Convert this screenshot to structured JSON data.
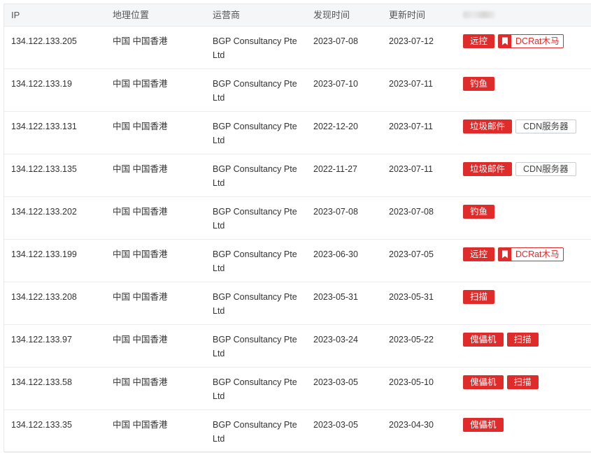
{
  "columns": [
    "IP",
    "地理位置",
    "运营商",
    "发现时间",
    "更新时间"
  ],
  "rows": [
    {
      "ip": "134.122.133.205",
      "location": "中国 中国香港",
      "isp_line1": "BGP Consultancy Pte",
      "isp_line2": "Ltd",
      "found": "2023-07-08",
      "updated": "2023-07-12",
      "tags": [
        {
          "text": "远控",
          "style": "red"
        },
        {
          "text": "DCRat木马",
          "style": "outline-red"
        }
      ]
    },
    {
      "ip": "134.122.133.19",
      "location": "中国 中国香港",
      "isp_line1": "BGP Consultancy Pte",
      "isp_line2": "Ltd",
      "found": "2023-07-10",
      "updated": "2023-07-11",
      "tags": [
        {
          "text": "钓鱼",
          "style": "red"
        }
      ]
    },
    {
      "ip": "134.122.133.131",
      "location": "中国 中国香港",
      "isp_line1": "BGP Consultancy Pte",
      "isp_line2": "Ltd",
      "found": "2022-12-20",
      "updated": "2023-07-11",
      "tags": [
        {
          "text": "垃圾邮件",
          "style": "red"
        },
        {
          "text": "CDN服务器",
          "style": "outline-gray"
        }
      ]
    },
    {
      "ip": "134.122.133.135",
      "location": "中国 中国香港",
      "isp_line1": "BGP Consultancy Pte",
      "isp_line2": "Ltd",
      "found": "2022-11-27",
      "updated": "2023-07-11",
      "tags": [
        {
          "text": "垃圾邮件",
          "style": "red"
        },
        {
          "text": "CDN服务器",
          "style": "outline-gray"
        }
      ]
    },
    {
      "ip": "134.122.133.202",
      "location": "中国 中国香港",
      "isp_line1": "BGP Consultancy Pte",
      "isp_line2": "Ltd",
      "found": "2023-07-08",
      "updated": "2023-07-08",
      "tags": [
        {
          "text": "钓鱼",
          "style": "red"
        }
      ]
    },
    {
      "ip": "134.122.133.199",
      "location": "中国 中国香港",
      "isp_line1": "BGP Consultancy Pte",
      "isp_line2": "Ltd",
      "found": "2023-06-30",
      "updated": "2023-07-05",
      "tags": [
        {
          "text": "远控",
          "style": "red"
        },
        {
          "text": "DCRat木马",
          "style": "outline-red"
        }
      ]
    },
    {
      "ip": "134.122.133.208",
      "location": "中国 中国香港",
      "isp_line1": "BGP Consultancy Pte",
      "isp_line2": "Ltd",
      "found": "2023-05-31",
      "updated": "2023-05-31",
      "tags": [
        {
          "text": "扫描",
          "style": "red"
        }
      ]
    },
    {
      "ip": "134.122.133.97",
      "location": "中国 中国香港",
      "isp_line1": "BGP Consultancy Pte",
      "isp_line2": "Ltd",
      "found": "2023-03-24",
      "updated": "2023-05-22",
      "tags": [
        {
          "text": "傀儡机",
          "style": "red"
        },
        {
          "text": "扫描",
          "style": "red"
        }
      ]
    },
    {
      "ip": "134.122.133.58",
      "location": "中国 中国香港",
      "isp_line1": "BGP Consultancy Pte",
      "isp_line2": "Ltd",
      "found": "2023-03-05",
      "updated": "2023-05-10",
      "tags": [
        {
          "text": "傀儡机",
          "style": "red"
        },
        {
          "text": "扫描",
          "style": "red"
        }
      ]
    },
    {
      "ip": "134.122.133.35",
      "location": "中国 中国香港",
      "isp_line1": "BGP Consultancy Pte",
      "isp_line2": "Ltd",
      "found": "2023-03-05",
      "updated": "2023-04-30",
      "tags": [
        {
          "text": "傀儡机",
          "style": "red"
        }
      ]
    }
  ],
  "colors": {
    "tag_red": "#e02b2b",
    "tag_gray_border": "#c8cdd3",
    "header_bg": "#f5f6f8"
  },
  "icons": {
    "bookmark": "bookmark-icon"
  }
}
